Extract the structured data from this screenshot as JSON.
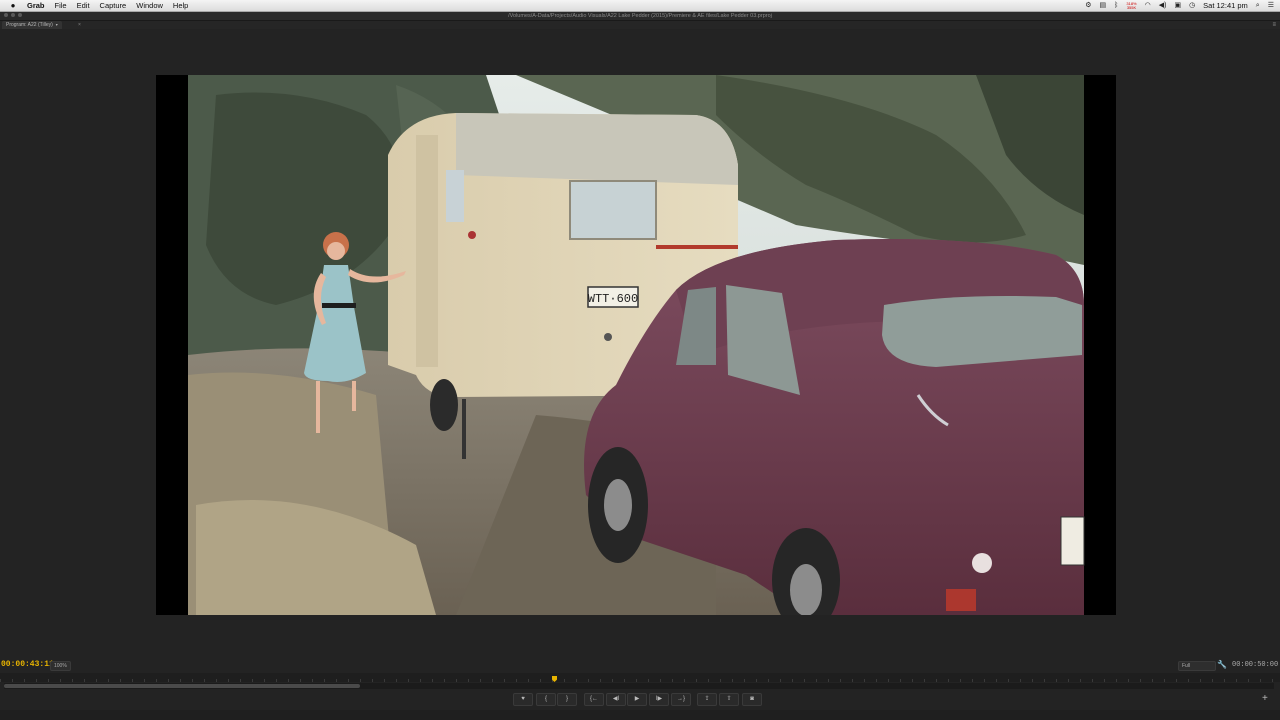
{
  "menubar": {
    "apple_icon": "apple-logo-icon",
    "app_name": "Grab",
    "menus": [
      "File",
      "Edit",
      "Capture",
      "Window",
      "Help"
    ],
    "status_icons": [
      "gear-icon",
      "printer-icon",
      "bluetooth-icon",
      "battery-icon",
      "wifi-icon",
      "volume-icon",
      "display-icon",
      "clock-icon"
    ],
    "battery_text": "318%",
    "battery_text2": "355K",
    "clock": "Sat 12:41 pm",
    "search_icon": "search-icon",
    "list_icon": "list-icon"
  },
  "window": {
    "path": "/Volumes/A-Data/Projects/Audio Visuals/A22 Lake Pedder (2015)/Premiere & AE files/Lake Pedder 03.prproj"
  },
  "panel": {
    "tab_label": "Program: A22 (Tilley)",
    "tab_menu": "▾",
    "close": "×",
    "panel_menu": "≡"
  },
  "controls": {
    "timecode_current": "00:00:43:11",
    "zoom_level": "100%",
    "playback_quality": "Full",
    "timecode_duration": "00:00:50:00",
    "playhead_position": 0.435,
    "transport_buttons": [
      {
        "name": "add-marker-button",
        "glyph": "♥"
      },
      {
        "name": "mark-in-button",
        "glyph": "{"
      },
      {
        "name": "mark-out-button",
        "glyph": "}"
      },
      {
        "name": "go-to-in-button",
        "glyph": "{←"
      },
      {
        "name": "step-back-button",
        "glyph": "◀I"
      },
      {
        "name": "play-button",
        "glyph": "▶"
      },
      {
        "name": "step-forward-button",
        "glyph": "I▶"
      },
      {
        "name": "go-to-out-button",
        "glyph": "→}"
      },
      {
        "name": "lift-button",
        "glyph": "⇪"
      },
      {
        "name": "extract-button",
        "glyph": "⇧"
      },
      {
        "name": "export-frame-button",
        "glyph": "◙"
      }
    ],
    "add_button": "+"
  },
  "video_frame": {
    "description_icon": "program-monitor-frame",
    "license_plate": "WTT·600"
  }
}
